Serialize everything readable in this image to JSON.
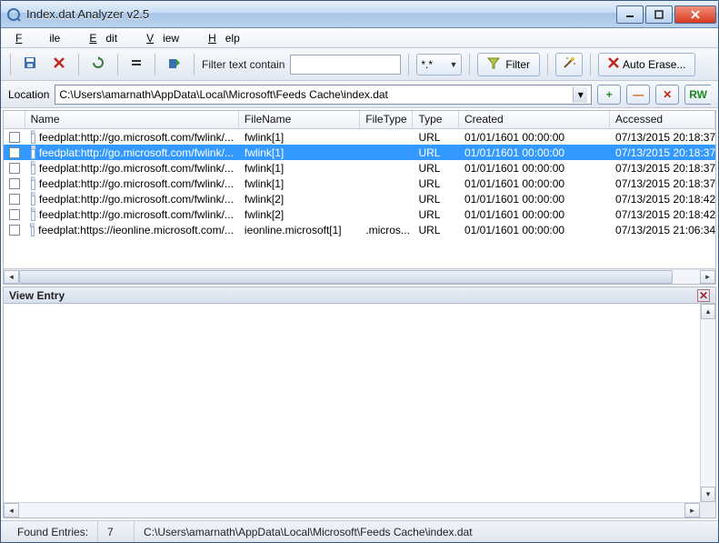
{
  "app": {
    "title": "Index.dat Analyzer v2.5"
  },
  "menu": {
    "file": "File",
    "edit": "Edit",
    "view": "View",
    "help": "Help"
  },
  "toolbar": {
    "filter_label": "Filter text contain",
    "filter_value": "",
    "pattern": "*.*",
    "filter_btn": "Filter",
    "auto_erase": "Auto Erase..."
  },
  "location": {
    "label": "Location",
    "path": "C:\\Users\\amarnath\\AppData\\Local\\Microsoft\\Feeds Cache\\index.dat",
    "rw": "RW"
  },
  "columns": {
    "name": "Name",
    "filename": "FileName",
    "filetype": "FileType",
    "type": "Type",
    "created": "Created",
    "accessed": "Accessed"
  },
  "rows": [
    {
      "selected": false,
      "name": "feedplat:http://go.microsoft.com/fwlink/...",
      "filename": "fwlink[1]",
      "filetype": "",
      "type": "URL",
      "created": "01/01/1601   00:00:00",
      "accessed": "07/13/2015   20:18:37"
    },
    {
      "selected": true,
      "name": "feedplat:http://go.microsoft.com/fwlink/...",
      "filename": "fwlink[1]",
      "filetype": "",
      "type": "URL",
      "created": "01/01/1601   00:00:00",
      "accessed": "07/13/2015   20:18:37"
    },
    {
      "selected": false,
      "name": "feedplat:http://go.microsoft.com/fwlink/...",
      "filename": "fwlink[1]",
      "filetype": "",
      "type": "URL",
      "created": "01/01/1601   00:00:00",
      "accessed": "07/13/2015   20:18:37"
    },
    {
      "selected": false,
      "name": "feedplat:http://go.microsoft.com/fwlink/...",
      "filename": "fwlink[1]",
      "filetype": "",
      "type": "URL",
      "created": "01/01/1601   00:00:00",
      "accessed": "07/13/2015   20:18:37"
    },
    {
      "selected": false,
      "name": "feedplat:http://go.microsoft.com/fwlink/...",
      "filename": "fwlink[2]",
      "filetype": "",
      "type": "URL",
      "created": "01/01/1601   00:00:00",
      "accessed": "07/13/2015   20:18:42"
    },
    {
      "selected": false,
      "name": "feedplat:http://go.microsoft.com/fwlink/...",
      "filename": "fwlink[2]",
      "filetype": "",
      "type": "URL",
      "created": "01/01/1601   00:00:00",
      "accessed": "07/13/2015   20:18:42"
    },
    {
      "selected": false,
      "name": "feedplat:https://ieonline.microsoft.com/...",
      "filename": "ieonline.microsoft[1]",
      "filetype": ".micros...",
      "type": "URL",
      "created": "01/01/1601   00:00:00",
      "accessed": "07/13/2015   21:06:34"
    }
  ],
  "view_entry": {
    "title": "View Entry"
  },
  "status": {
    "found_label": "Found Entries:",
    "found_count": "7",
    "path": "C:\\Users\\amarnath\\AppData\\Local\\Microsoft\\Feeds Cache\\index.dat"
  }
}
